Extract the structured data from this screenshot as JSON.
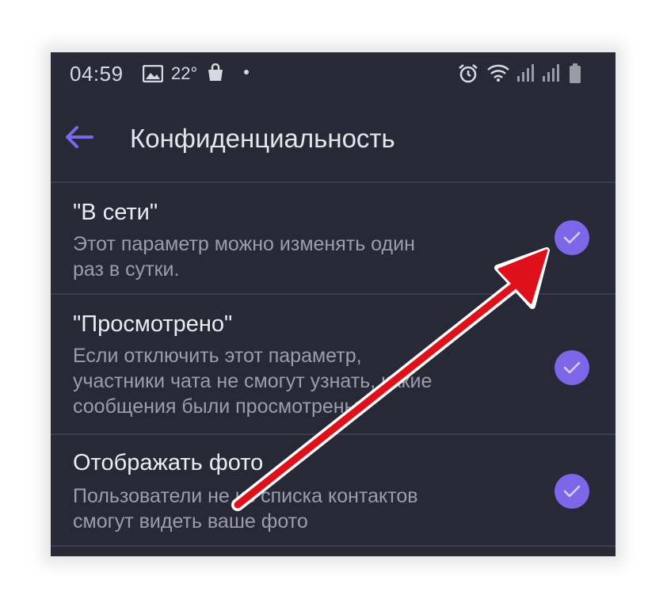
{
  "status_bar": {
    "time": "04:59",
    "temperature": "22°",
    "icons": [
      "gallery-icon",
      "bag-icon",
      "alarm-icon",
      "wifi-icon",
      "signal-icon",
      "signal-icon",
      "battery-icon"
    ]
  },
  "toolbar": {
    "title": "Конфиденциальность",
    "back_icon": "arrow-left-icon"
  },
  "settings": [
    {
      "title": "\"В сети\"",
      "line1": "Этот параметр можно изменять один",
      "line2": "раз в сутки.",
      "line3": "",
      "checked": true
    },
    {
      "title": "\"Просмотрено\"",
      "line1": "Если отключить этот параметр,",
      "line2": "участники чата не смогут узнать, какие",
      "line3": "сообщения были просмотрены.",
      "checked": true
    },
    {
      "title": "Отображать фото",
      "line1": "Пользователи не из списка контактов",
      "line2": "смогут видеть ваше фото",
      "line3": "",
      "checked": true
    }
  ],
  "colors": {
    "background": "#272a36",
    "accent": "#7d66e8",
    "annotation_arrow": "#e0101a"
  }
}
